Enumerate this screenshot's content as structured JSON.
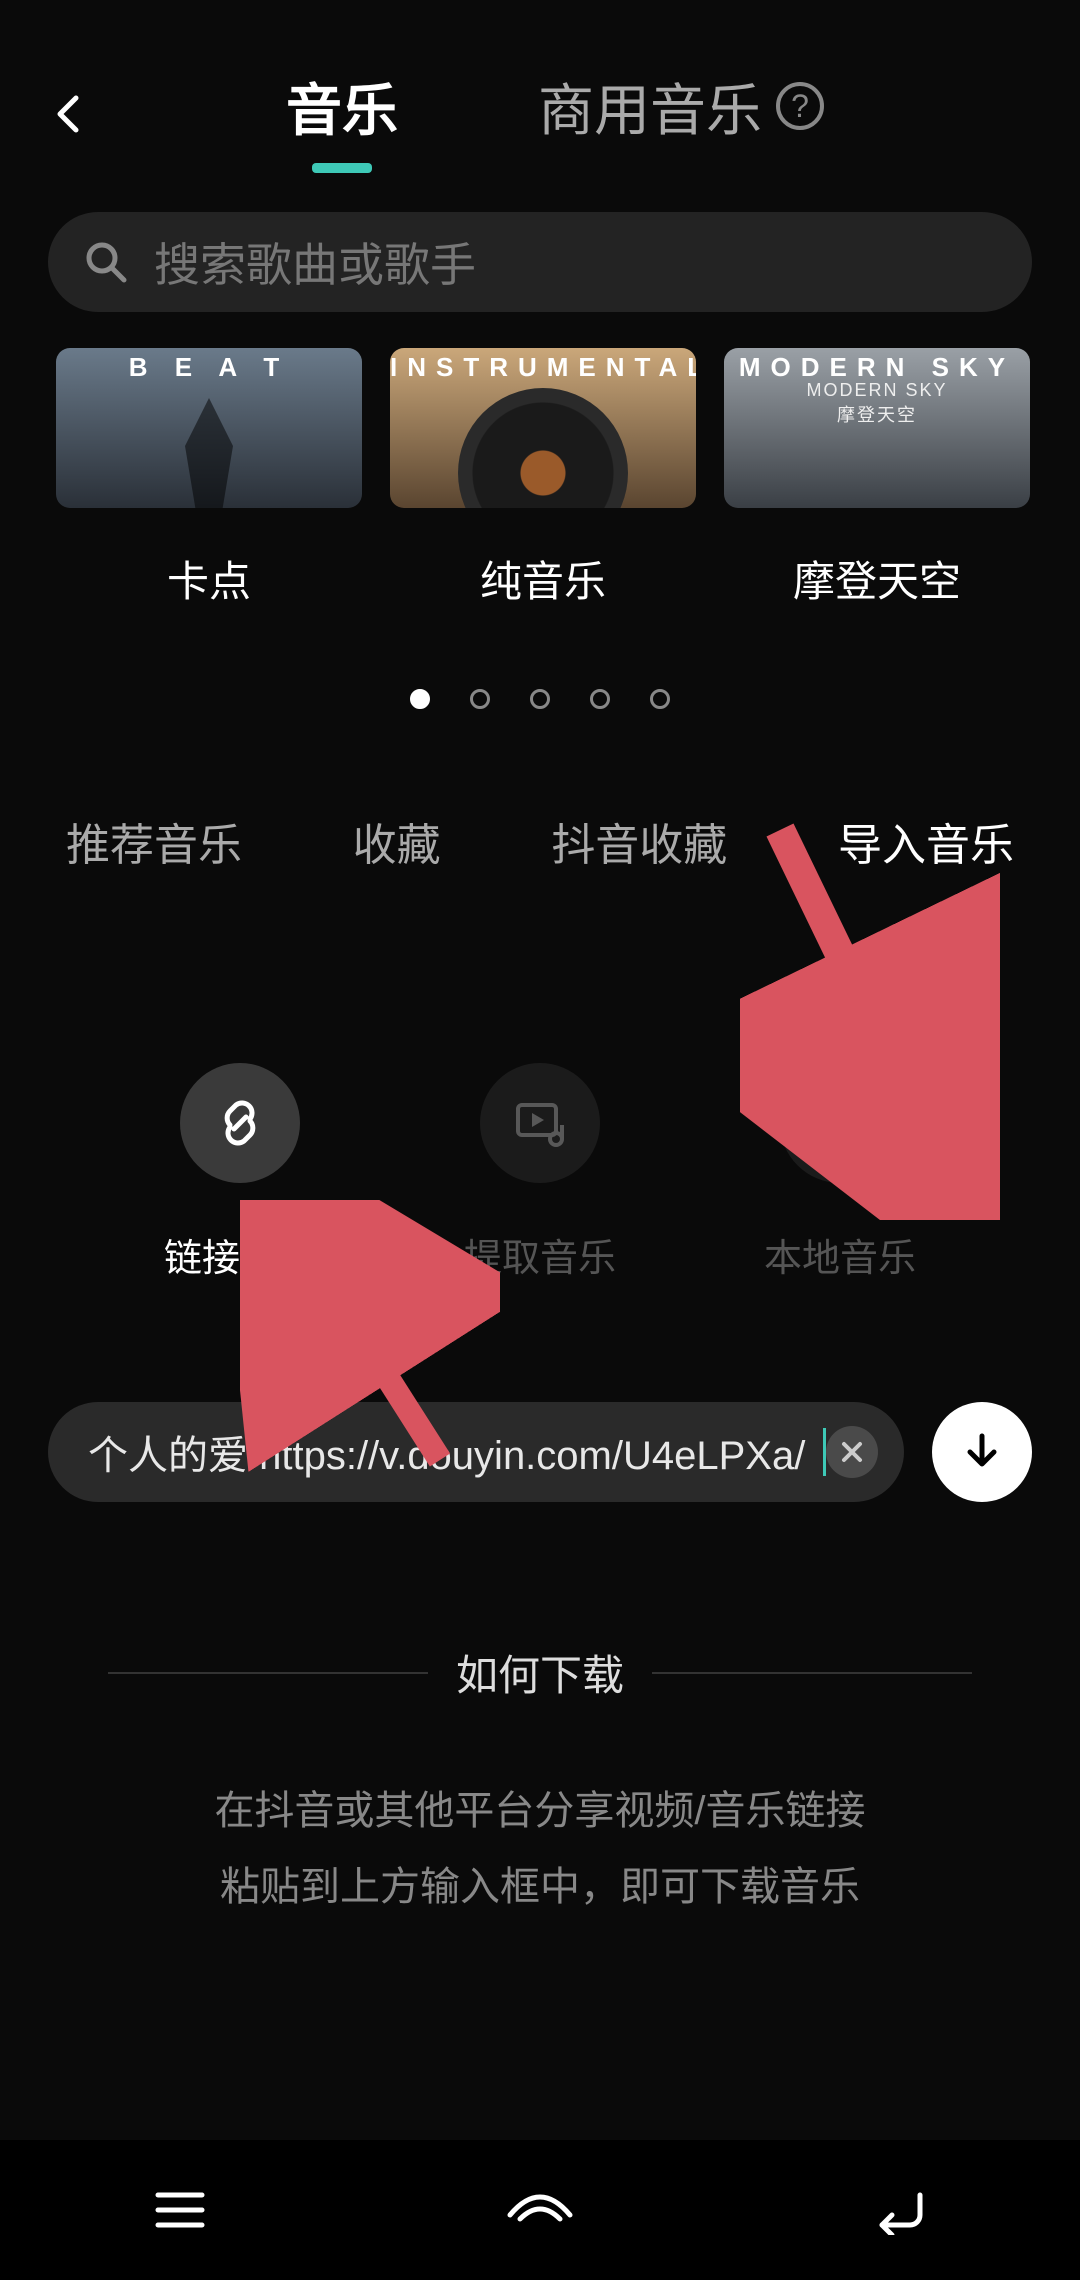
{
  "header": {
    "tab_music": "音乐",
    "tab_commercial": "商用音乐"
  },
  "search": {
    "placeholder": "搜索歌曲或歌手"
  },
  "categories": [
    {
      "thumb_text": "B E A T",
      "label": "卡点"
    },
    {
      "thumb_text": "INSTRUMENTAL",
      "label": "纯音乐"
    },
    {
      "thumb_text": "MODERN SKY",
      "sub1": "MODERN SKY",
      "sub2": "摩登天空",
      "label": "摩登天空"
    }
  ],
  "music_tabs": {
    "recommend": "推荐音乐",
    "favorite": "收藏",
    "douyin_fav": "抖音收藏",
    "import": "导入音乐"
  },
  "import_options": {
    "link": "链接下载",
    "extract": "提取音乐",
    "local": "本地音乐"
  },
  "url_input": {
    "value": "个人的爱  https://v.douyin.com/U4eLPXa/"
  },
  "howto": {
    "title": "如何下载",
    "line1": "在抖音或其他平台分享视频/音乐链接",
    "line2": "粘贴到上方输入框中，即可下载音乐"
  },
  "colors": {
    "accent": "#3ec9b7",
    "annotation": "#d9545f"
  }
}
